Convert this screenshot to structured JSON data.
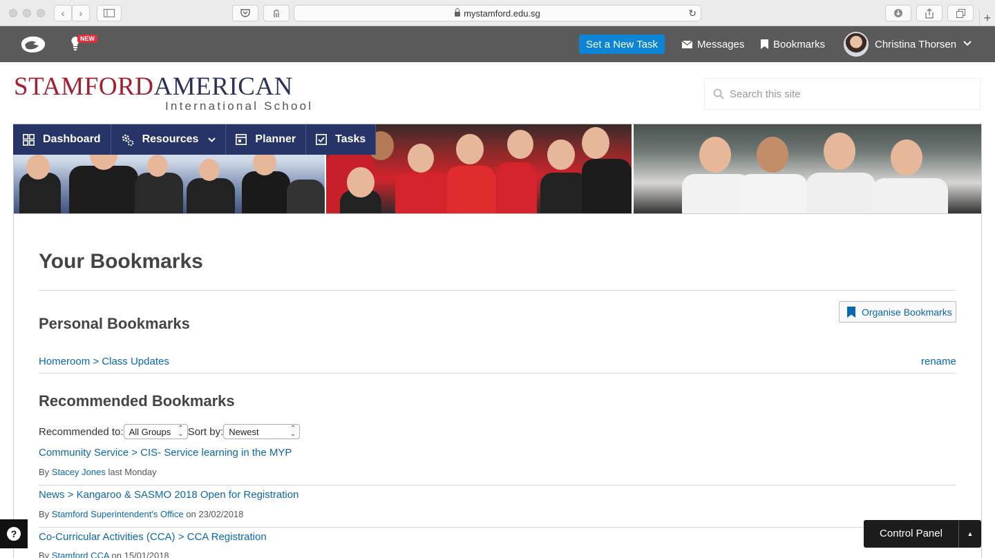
{
  "browser": {
    "url": "mystamford.edu.sg"
  },
  "appbar": {
    "new_badge": "NEW",
    "task_button": "Set a New Task",
    "messages": "Messages",
    "bookmarks": "Bookmarks",
    "user_name": "Christina Thorsen"
  },
  "header": {
    "logo_line1_a": "STAMFORD",
    "logo_line1_b": "AMERICAN",
    "logo_line2": "International School",
    "search_placeholder": "Search this site"
  },
  "nav": {
    "items": [
      {
        "label": "Dashboard"
      },
      {
        "label": "Resources"
      },
      {
        "label": "Planner"
      },
      {
        "label": "Tasks"
      }
    ]
  },
  "page": {
    "title": "Your Bookmarks",
    "organise_button": "Organise Bookmarks",
    "personal": {
      "heading": "Personal Bookmarks",
      "items": [
        {
          "link": "Homeroom > Class Updates",
          "action": "rename"
        }
      ]
    },
    "recommended": {
      "heading": "Recommended Bookmarks",
      "recommended_to_label": "Recommended to:",
      "recommended_to_value": "All Groups",
      "sort_label": "Sort by:",
      "sort_value": "Newest",
      "items": [
        {
          "link": "Community Service > CIS- Service learning in the MYP",
          "by": "By",
          "author": "Stacey Jones",
          "when": "last Monday"
        },
        {
          "link": "News > Kangaroo & SASMO 2018 Open for Registration",
          "by": "By",
          "author": "Stamford Superintendent's Office",
          "when": "on 23/02/2018"
        },
        {
          "link": "Co-Curricular Activities (CCA) > CCA Registration",
          "by": "By",
          "author": "Stamford CCA",
          "when": "on 15/01/2018"
        }
      ]
    }
  },
  "footer": {
    "help_icon": "?",
    "control_panel": "Control Panel"
  },
  "colors": {
    "appbar": "#5a5a5a",
    "primary_button": "#0c85d6",
    "nav": "#263467",
    "link": "#0b67b2",
    "logo_red": "#a41e2d",
    "logo_navy": "#2b3259"
  }
}
